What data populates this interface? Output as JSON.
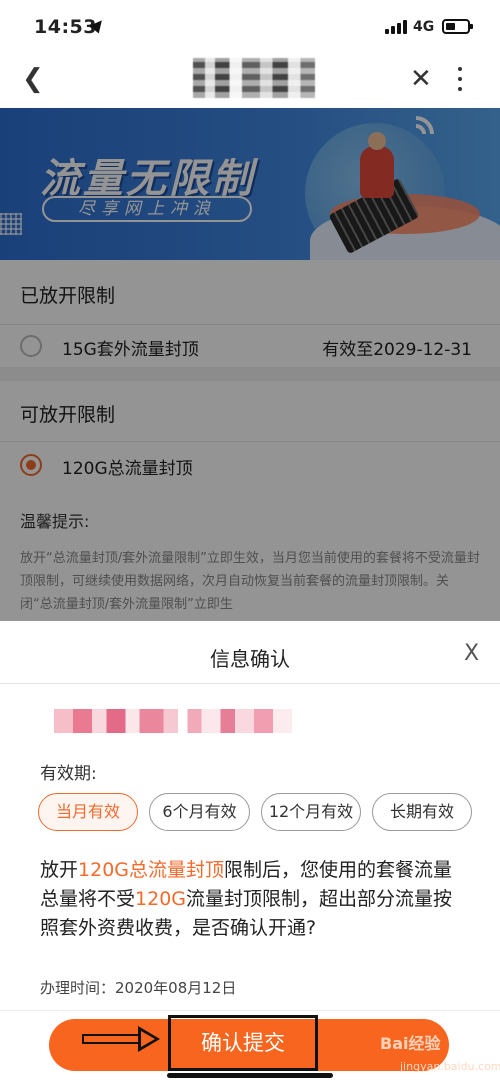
{
  "status_bar": {
    "time": "14:53",
    "network": "4G"
  },
  "banner": {
    "title": "流量无限制",
    "subtitle": "尽享网上冲浪"
  },
  "released": {
    "heading": "已放开限制",
    "item_label": "15G套外流量封顶",
    "item_valid": "有效至2029-12-31"
  },
  "available": {
    "heading": "可放开限制",
    "item_label": "120G总流量封顶"
  },
  "tips": {
    "title": "温馨提示:",
    "body": "放开“总流量封顶/套外流量限制”立即生效，当月您当前使用的套餐将不受流量封顶限制，可继续使用数据网络，次月自动恢复当前套餐的流量封顶限制。关闭“总流量封顶/套外流量限制”立即生"
  },
  "modal": {
    "title": "信息确认",
    "close": "X",
    "period_label": "有效期:",
    "options": [
      "当月有效",
      "6个月有效",
      "12个月有效",
      "长期有效"
    ],
    "selected_option": "当月有效",
    "desc_1": "放开",
    "desc_hl_1": "120G总流量封顶",
    "desc_2": "限制后，您使用的套餐流量总量将不受",
    "desc_hl_2": "120G",
    "desc_3": "流量封顶限制，超出部分流量按照套外资费收费，是否确认开通?",
    "handle_time": "办理时间：2020年08月12日",
    "submit": "确认提交"
  },
  "watermark": {
    "text": "Bai经验",
    "sub": "jingyan.baidu.com"
  },
  "colors": {
    "accent": "#f36a2c",
    "button": "#f8651e",
    "banner": "#3f86e0"
  },
  "icons": [
    "location-arrow-icon",
    "signal-icon",
    "battery-icon",
    "back-icon",
    "close-icon",
    "more-icon",
    "radio-icon",
    "arrow-icon"
  ]
}
